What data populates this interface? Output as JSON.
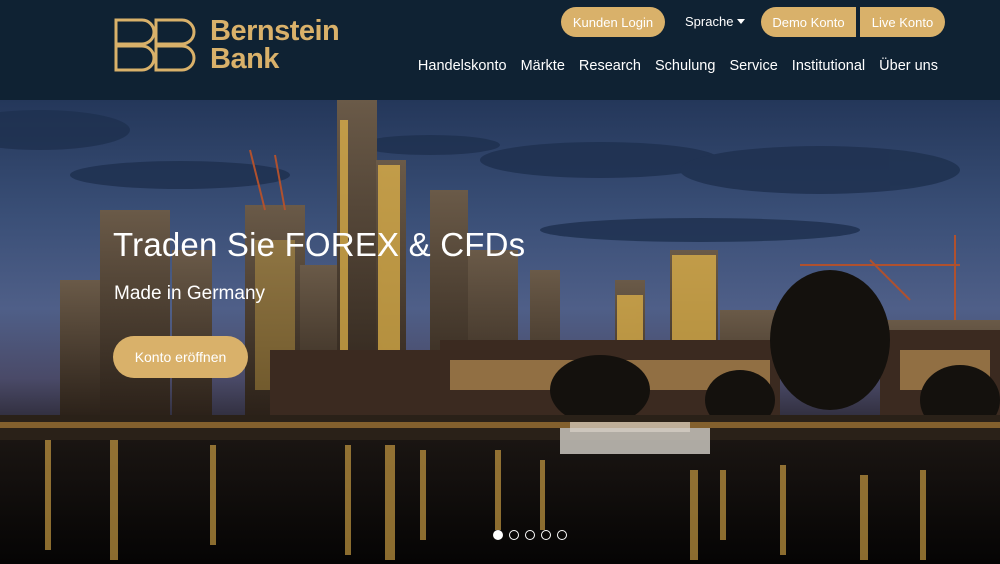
{
  "brand": {
    "line1": "Bernstein",
    "line2": "Bank",
    "color": "#d9b16a"
  },
  "header": {
    "login_label": "Kunden Login",
    "language_label": "Sprache",
    "demo_label": "Demo Konto",
    "live_label": "Live Konto",
    "nav": [
      {
        "label": "Handelskonto"
      },
      {
        "label": "Märkte"
      },
      {
        "label": "Research"
      },
      {
        "label": "Schulung"
      },
      {
        "label": "Service"
      },
      {
        "label": "Institutional"
      },
      {
        "label": "Über uns"
      }
    ]
  },
  "hero": {
    "title": "Traden Sie FOREX & CFDs",
    "subtitle": "Made in Germany",
    "cta_label": "Konto eröffnen",
    "slides_total": 5,
    "active_slide": 1
  },
  "colors": {
    "header_bg": "#0f2233",
    "accent": "#d9b16a"
  }
}
